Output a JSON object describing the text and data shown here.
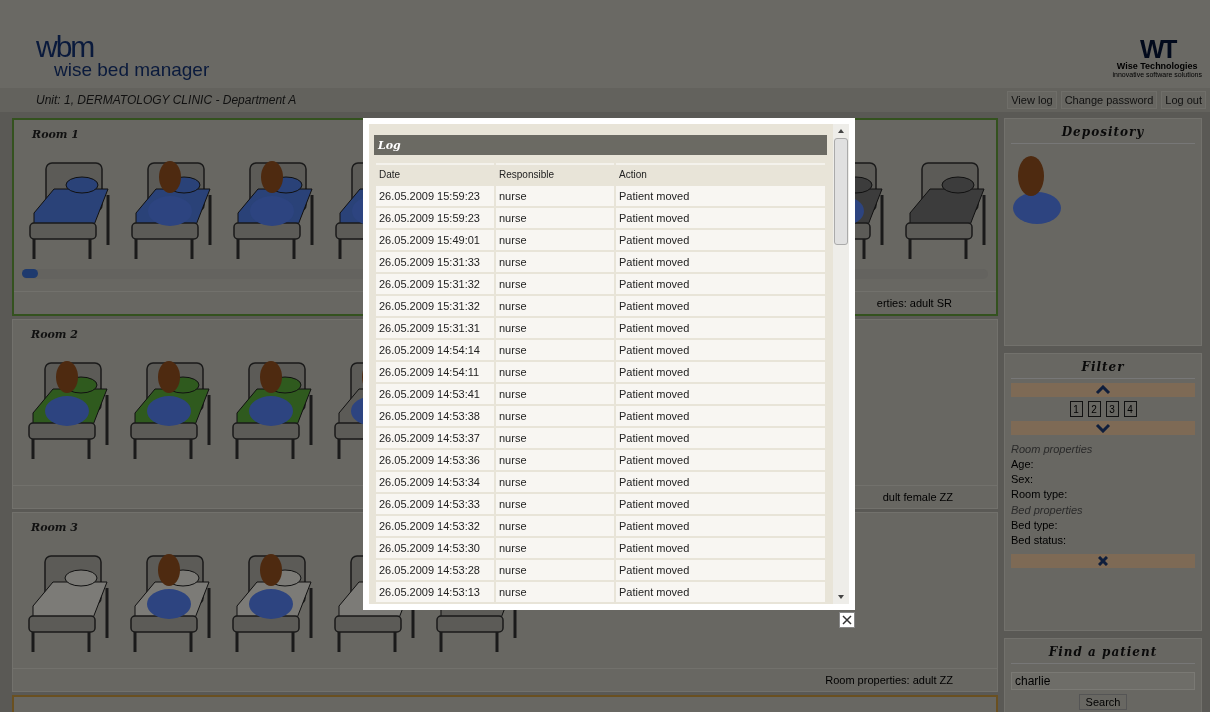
{
  "header": {
    "logo_mark": "wbm",
    "logo_text": "wise bed manager",
    "company_mark": "WT",
    "company_name": "Wise Technologies",
    "company_tagline": "innovative software solutions"
  },
  "unit_bar": {
    "unit": "Unit: 1, DERMATOLOGY CLINIC - Department A",
    "links": [
      "View log",
      "Change password",
      "Log out"
    ]
  },
  "rooms": [
    {
      "title": "Room 1",
      "color": "#34521f",
      "scroll": true,
      "properties": "erties: adult SR",
      "beds": [
        {
          "kind": "empty",
          "color": "#2a4278"
        },
        {
          "kind": "occupied",
          "color": "#2a4278"
        },
        {
          "kind": "occupied",
          "color": "#2a4278"
        },
        {
          "kind": "occupied",
          "color": "#2a4278"
        }
      ],
      "beds_far": [
        {
          "kind": "occupied",
          "color": "#3c3c3c"
        },
        {
          "kind": "empty",
          "color": "#3c3c3c"
        }
      ]
    },
    {
      "title": "Room 2",
      "properties": "dult female ZZ",
      "beds": [
        {
          "kind": "occupied",
          "color": "#2f5a1e"
        },
        {
          "kind": "occupied",
          "color": "#2f5a1e"
        },
        {
          "kind": "occupied",
          "color": "#2f5a1e"
        },
        {
          "kind": "occupied"
        }
      ]
    },
    {
      "title": "Room 3",
      "properties": "Room properties: adult ZZ",
      "beds": [
        {
          "kind": "empty",
          "color": "#7c7b77"
        },
        {
          "kind": "occupied",
          "color": "#7c7b77"
        },
        {
          "kind": "occupied",
          "color": "#7c7b77"
        },
        {
          "kind": "empty",
          "color": "#7c7b77"
        },
        {
          "kind": "empty"
        }
      ]
    },
    {
      "color": "#6a5020"
    }
  ],
  "depository": {
    "title": "Depository"
  },
  "filter": {
    "title": "Filter",
    "pages": [
      "1",
      "2",
      "3",
      "4"
    ],
    "room_heading": "Room properties",
    "room_fields": [
      "Age:",
      "Sex:",
      "Room type:"
    ],
    "bed_heading": "Bed properties",
    "bed_fields": [
      "Bed type:",
      "Bed status:"
    ]
  },
  "find": {
    "title": "Find a patient",
    "value": "charlie",
    "button": "Search"
  },
  "log": {
    "title": "Log",
    "columns": [
      "Date",
      "Responsible",
      "Action"
    ],
    "rows": [
      [
        "26.05.2009 15:59:23",
        "nurse",
        "Patient moved"
      ],
      [
        "26.05.2009 15:59:23",
        "nurse",
        "Patient moved"
      ],
      [
        "26.05.2009 15:49:01",
        "nurse",
        "Patient moved"
      ],
      [
        "26.05.2009 15:31:33",
        "nurse",
        "Patient moved"
      ],
      [
        "26.05.2009 15:31:32",
        "nurse",
        "Patient moved"
      ],
      [
        "26.05.2009 15:31:32",
        "nurse",
        "Patient moved"
      ],
      [
        "26.05.2009 15:31:31",
        "nurse",
        "Patient moved"
      ],
      [
        "26.05.2009 14:54:14",
        "nurse",
        "Patient moved"
      ],
      [
        "26.05.2009 14:54:11",
        "nurse",
        "Patient moved"
      ],
      [
        "26.05.2009 14:53:41",
        "nurse",
        "Patient moved"
      ],
      [
        "26.05.2009 14:53:38",
        "nurse",
        "Patient moved"
      ],
      [
        "26.05.2009 14:53:37",
        "nurse",
        "Patient moved"
      ],
      [
        "26.05.2009 14:53:36",
        "nurse",
        "Patient moved"
      ],
      [
        "26.05.2009 14:53:34",
        "nurse",
        "Patient moved"
      ],
      [
        "26.05.2009 14:53:33",
        "nurse",
        "Patient moved"
      ],
      [
        "26.05.2009 14:53:32",
        "nurse",
        "Patient moved"
      ],
      [
        "26.05.2009 14:53:30",
        "nurse",
        "Patient moved"
      ],
      [
        "26.05.2009 14:53:28",
        "nurse",
        "Patient moved"
      ],
      [
        "26.05.2009 14:53:13",
        "nurse",
        "Patient moved"
      ]
    ]
  }
}
